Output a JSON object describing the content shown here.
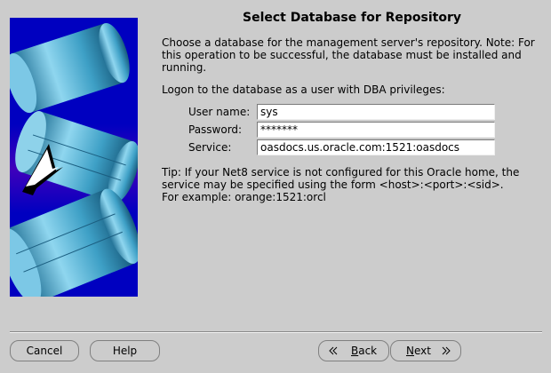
{
  "dialog": {
    "title": "Select Database for Repository",
    "intro": "Choose a database for the management server's repository. Note: For this operation to be successful, the database must be installed and running.",
    "logon_instruction": "Logon to the database as a user with DBA privileges:",
    "fields": {
      "user_name": {
        "label": "User name:",
        "value": "sys"
      },
      "password": {
        "label": "Password:",
        "value": "*******"
      },
      "service": {
        "label": "Service:",
        "value": "oasdocs.us.oracle.com:1521:oasdocs"
      }
    },
    "tip": {
      "line1": "Tip: If your Net8 service is not configured for this Oracle home, the",
      "line2": "service may be specified using the form <host>:<port>:<sid>.",
      "line3": "For example: orange:1521:orcl"
    }
  },
  "buttons": {
    "cancel": "Cancel",
    "help": "Help",
    "back_mnemonic": "B",
    "back_rest": "ack",
    "next_mnemonic": "N",
    "next_rest": "ext"
  },
  "icons": {
    "back": "chevron-left-double-icon",
    "next": "chevron-right-double-icon",
    "art": "database-cylinders-illustration"
  },
  "colors": {
    "background": "#cccccc",
    "art_background": "#0000c0",
    "cylinder": "#4aa8cc"
  }
}
